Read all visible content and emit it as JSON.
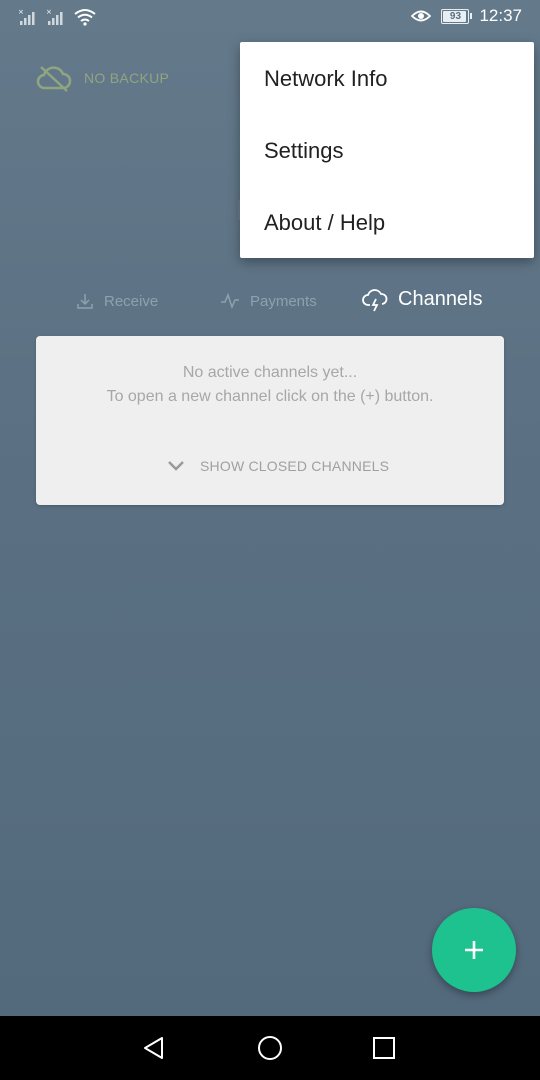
{
  "status_bar": {
    "time": "12:37",
    "battery": "93",
    "icons": [
      "signal-no-sim-icon",
      "signal-no-sim-icon",
      "wifi-icon",
      "eye-icon",
      "battery-icon"
    ]
  },
  "backup": {
    "label": "NO BACKUP",
    "icon": "cloud-off-icon",
    "color": "#98ad7f"
  },
  "tabs": [
    {
      "label": "Receive",
      "icon": "download-icon",
      "active": false
    },
    {
      "label": "Payments",
      "icon": "pulse-icon",
      "active": false
    },
    {
      "label": "Channels",
      "icon": "cloud-lightning-icon",
      "active": true
    }
  ],
  "channels_card": {
    "line1": "No active channels yet...",
    "line2": "To open a new channel click on the (+) button.",
    "show_closed_label": "SHOW CLOSED CHANNELS"
  },
  "menu": {
    "items": [
      "Network Info",
      "Settings",
      "About / Help"
    ]
  },
  "fab": {
    "label": "+",
    "color": "#1ec28f"
  },
  "nav": {
    "icons": [
      "back-icon",
      "home-icon",
      "recent-apps-icon"
    ]
  }
}
